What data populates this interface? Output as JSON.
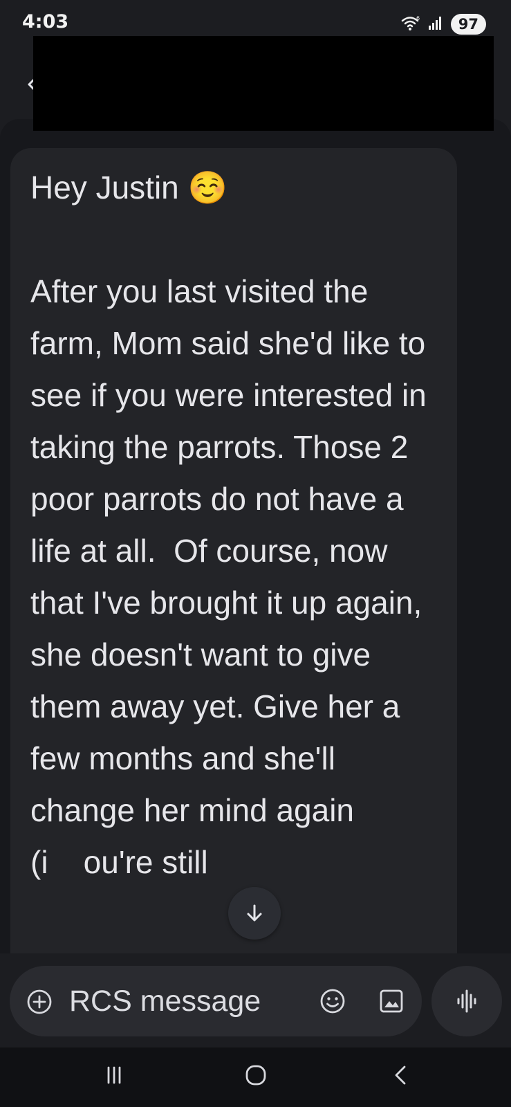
{
  "status_bar": {
    "time": "4:03",
    "battery_level": "97",
    "icons": [
      "wifi-icon",
      "signal-icon",
      "battery-icon"
    ]
  },
  "header": {
    "back_icon": "back-arrow-icon",
    "contact_redacted": true
  },
  "message": {
    "text": "Hey Justin ☺️\n\nAfter you last visited the farm, Mom said she'd like to see if you were interested in taking the parrots. Those 2 poor parrots do not have a life at all.  Of course, now that I've brought it up again, she doesn't want to give them away yet. Give her a few months and she'll change her mind again (i    ou're still"
  },
  "composer": {
    "placeholder": "RCS message",
    "value": ""
  },
  "colors": {
    "background": "#1c1d21",
    "bubble": "#232428",
    "composer": "#2a2b30",
    "text": "#e4e5ea",
    "nav_bar": "#101114"
  }
}
